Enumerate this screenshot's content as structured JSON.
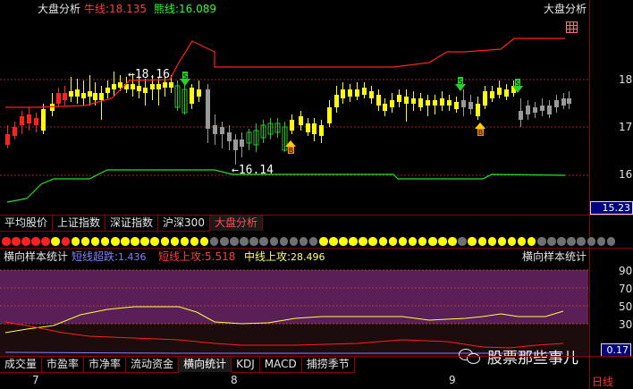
{
  "chart_title": "大盘分析",
  "legend": {
    "bull": "牛线:18.135",
    "bear": "熊线:16.089"
  },
  "price_axis": {
    "labels": [
      "18",
      "17",
      "16"
    ],
    "current": "15.23"
  },
  "annotations": {
    "high": "←18.16",
    "low": "←16.14",
    "sell_marker": "S",
    "buy_marker": "B"
  },
  "index_tabs": [
    {
      "label": "平均股价",
      "active": false
    },
    {
      "label": "上证指数",
      "active": false
    },
    {
      "label": "深证指数",
      "active": false
    },
    {
      "label": "沪深300",
      "active": false
    },
    {
      "label": "大盘分析",
      "active": true
    }
  ],
  "dot_colors": [
    "#ff2020",
    "#ff2020",
    "#ff2020",
    "#ff2020",
    "#ff2020",
    "#ffff00",
    "#ff2020",
    "#ffff00",
    "#ffff00",
    "#ffff00",
    "#ffff00",
    "#ffff00",
    "#ffff00",
    "#ffff00",
    "#ffff00",
    "#ffff00",
    "#ffff00",
    "#ffff00",
    "#ffff00",
    "#ffff00",
    "#ffff00",
    "#707070",
    "#707070",
    "#707070",
    "#707070",
    "#707070",
    "#707070",
    "#707070",
    "#707070",
    "#707070",
    "#707070",
    "#707070",
    "#ffff00",
    "#ffff00",
    "#ffff00",
    "#ffff00",
    "#ffff00",
    "#ffff00",
    "#ffff00",
    "#ffff00",
    "#ffff00",
    "#ffff00",
    "#ffff00",
    "#ffff00",
    "#ffff00",
    "#ffff00",
    "#707070",
    "#ffff00",
    "#ffff00",
    "#ffff00",
    "#ffff00",
    "#ffff00",
    "#ffff00",
    "#ffff00",
    "#707070",
    "#707070",
    "#707070",
    "#707070",
    "#707070",
    "#707070",
    "#707070",
    "#707070"
  ],
  "indicator": {
    "title": "横向样本统计",
    "short_label": "短线超跌:",
    "short_value": "1.436",
    "mid_short_label": "短线上攻:",
    "mid_short_value": "5.518",
    "mid_label": "中线上攻:",
    "mid_value": "28.496",
    "title_right": "横向样本统计",
    "y_labels": [
      "90",
      "70",
      "50",
      "30"
    ],
    "current": "0.17"
  },
  "bottom_tabs": [
    {
      "label": "成交量",
      "active": false
    },
    {
      "label": "市盈率",
      "active": false
    },
    {
      "label": "市净率",
      "active": false
    },
    {
      "label": "流动资金",
      "active": false
    },
    {
      "label": "横向统计",
      "active": true
    },
    {
      "label": "KDJ",
      "active": false
    },
    {
      "label": "MACD",
      "active": false
    },
    {
      "label": "捕捞季节",
      "active": false
    }
  ],
  "x_axis_labels": [
    "7",
    "8",
    "9"
  ],
  "line_mode": "日线",
  "watermark": "股票那些事儿",
  "colors": {
    "bull": "#ff2020",
    "bear": "#28e028",
    "up_candle": "#ffff00",
    "down_candle": "#28c828",
    "neutral": "#9a9a9a",
    "indicator_band": "#5a1f56"
  }
}
